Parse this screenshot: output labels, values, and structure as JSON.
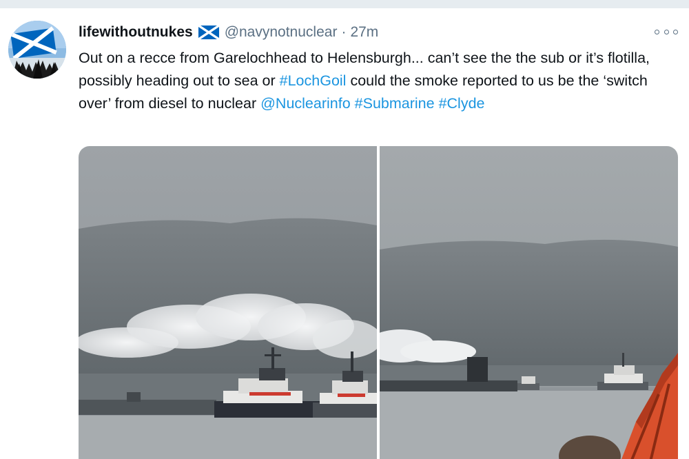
{
  "tweet": {
    "display_name": "lifewithoutnukes",
    "handle": "@navynotnuclear",
    "separator": "·",
    "time": "27m",
    "text_parts": {
      "t1": "Out on a recce from Garelochhead to Helensburgh... can’t see the the sub or it’s flotilla, possibly heading out to sea or ",
      "l1": "#LochGoil",
      "t2": " could the smoke reported to us be the ‘switch over’ from diesel to nuclear ",
      "l2": "@Nuclearinfo",
      "t3": " ",
      "l3": "#Submarine",
      "t4": " ",
      "l4": "#Clyde"
    },
    "icons": {
      "avatar": "profile-avatar",
      "flag": "scotland-flag-icon",
      "more": "more-options-icon"
    },
    "colors": {
      "link": "#1b95e0",
      "secondary_text": "#5b7083",
      "primary_text": "#0f1419"
    }
  }
}
